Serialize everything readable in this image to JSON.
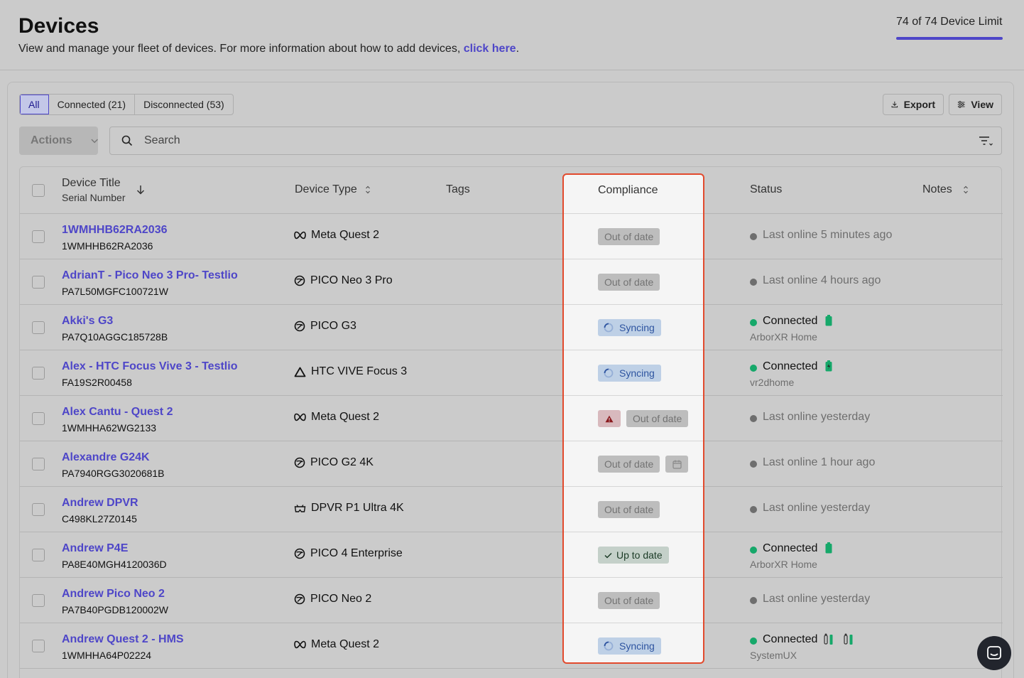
{
  "header": {
    "title": "Devices",
    "subtitle": "View and manage your fleet of devices. For more information about how to add devices,",
    "link_text": "click here",
    "trailing": ".",
    "device_limit": "74 of 74 Device Limit"
  },
  "filters": {
    "tabs": [
      {
        "label": "All",
        "active": true
      },
      {
        "label": "Connected (21)",
        "active": false
      },
      {
        "label": "Disconnected (53)",
        "active": false
      }
    ],
    "export_label": "Export",
    "view_label": "View",
    "actions_label": "Actions",
    "search_placeholder": "Search"
  },
  "table": {
    "headers": {
      "device_title": "Device Title",
      "serial_number": "Serial Number",
      "device_type": "Device Type",
      "tags": "Tags",
      "compliance": "Compliance",
      "status": "Status",
      "notes": "Notes"
    },
    "rows": [
      {
        "title": "1WMHHB62RA2036",
        "serial": "1WMHHB62RA2036",
        "type": "Meta Quest 2",
        "type_icon": "meta-icon",
        "compliance": "Out of date",
        "compliance_kind": "out",
        "status": "Last online 5 minutes ago",
        "connected": false,
        "network": ""
      },
      {
        "title": "AdrianT - Pico Neo 3 Pro- Testlio",
        "serial": "PA7L50MGFC100721W",
        "type": "PICO Neo 3 Pro",
        "type_icon": "pico-icon",
        "compliance": "Out of date",
        "compliance_kind": "out",
        "status": "Last online 4 hours ago",
        "connected": false,
        "network": ""
      },
      {
        "title": "Akki's G3",
        "serial": "PA7Q10AGGC185728B",
        "type": "PICO G3",
        "type_icon": "pico-icon",
        "compliance": "Syncing",
        "compliance_kind": "sync",
        "status": "Connected",
        "connected": true,
        "network": "ArborXR Home",
        "battery": "full"
      },
      {
        "title": "Alex - HTC Focus Vive 3 - Testlio",
        "serial": "FA19S2R00458",
        "type": "HTC VIVE Focus 3",
        "type_icon": "htc-icon",
        "compliance": "Syncing",
        "compliance_kind": "sync",
        "status": "Connected",
        "connected": true,
        "network": "vr2dhome",
        "battery": "charging"
      },
      {
        "title": "Alex Cantu - Quest 2",
        "serial": "1WMHHA62WG2133",
        "type": "Meta Quest 2",
        "type_icon": "meta-icon",
        "compliance": "Out of date",
        "compliance_kind": "warn",
        "status": "Last online yesterday",
        "connected": false,
        "network": ""
      },
      {
        "title": "Alexandre G24K",
        "serial": "PA7940RGG3020681B",
        "type": "PICO G2 4K",
        "type_icon": "pico-icon",
        "compliance": "Out of date",
        "compliance_kind": "cal",
        "status": "Last online 1 hour ago",
        "connected": false,
        "network": ""
      },
      {
        "title": "Andrew DPVR",
        "serial": "C498KL27Z0145",
        "type": "DPVR P1 Ultra 4K",
        "type_icon": "dpvr-icon",
        "compliance": "Out of date",
        "compliance_kind": "out",
        "status": "Last online yesterday",
        "connected": false,
        "network": ""
      },
      {
        "title": "Andrew P4E",
        "serial": "PA8E40MGH4120036D",
        "type": "PICO 4 Enterprise",
        "type_icon": "pico-icon",
        "compliance": "Up to date",
        "compliance_kind": "up",
        "status": "Connected",
        "connected": true,
        "network": "ArborXR Home",
        "battery": "full"
      },
      {
        "title": "Andrew Pico Neo 2",
        "serial": "PA7B40PGDB120002W",
        "type": "PICO Neo 2",
        "type_icon": "pico-icon",
        "compliance": "Out of date",
        "compliance_kind": "out",
        "status": "Last online yesterday",
        "connected": false,
        "network": ""
      },
      {
        "title": "Andrew Quest 2 - HMS",
        "serial": "1WMHHA64P02224",
        "type": "Meta Quest 2",
        "type_icon": "meta-icon",
        "compliance": "Syncing",
        "compliance_kind": "sync",
        "status": "Connected",
        "connected": true,
        "network": "SystemUX",
        "battery": "controllers"
      }
    ]
  },
  "colors": {
    "accent": "#4e46c8",
    "highlight_border": "#e24a2d",
    "connected": "#16a86a"
  }
}
